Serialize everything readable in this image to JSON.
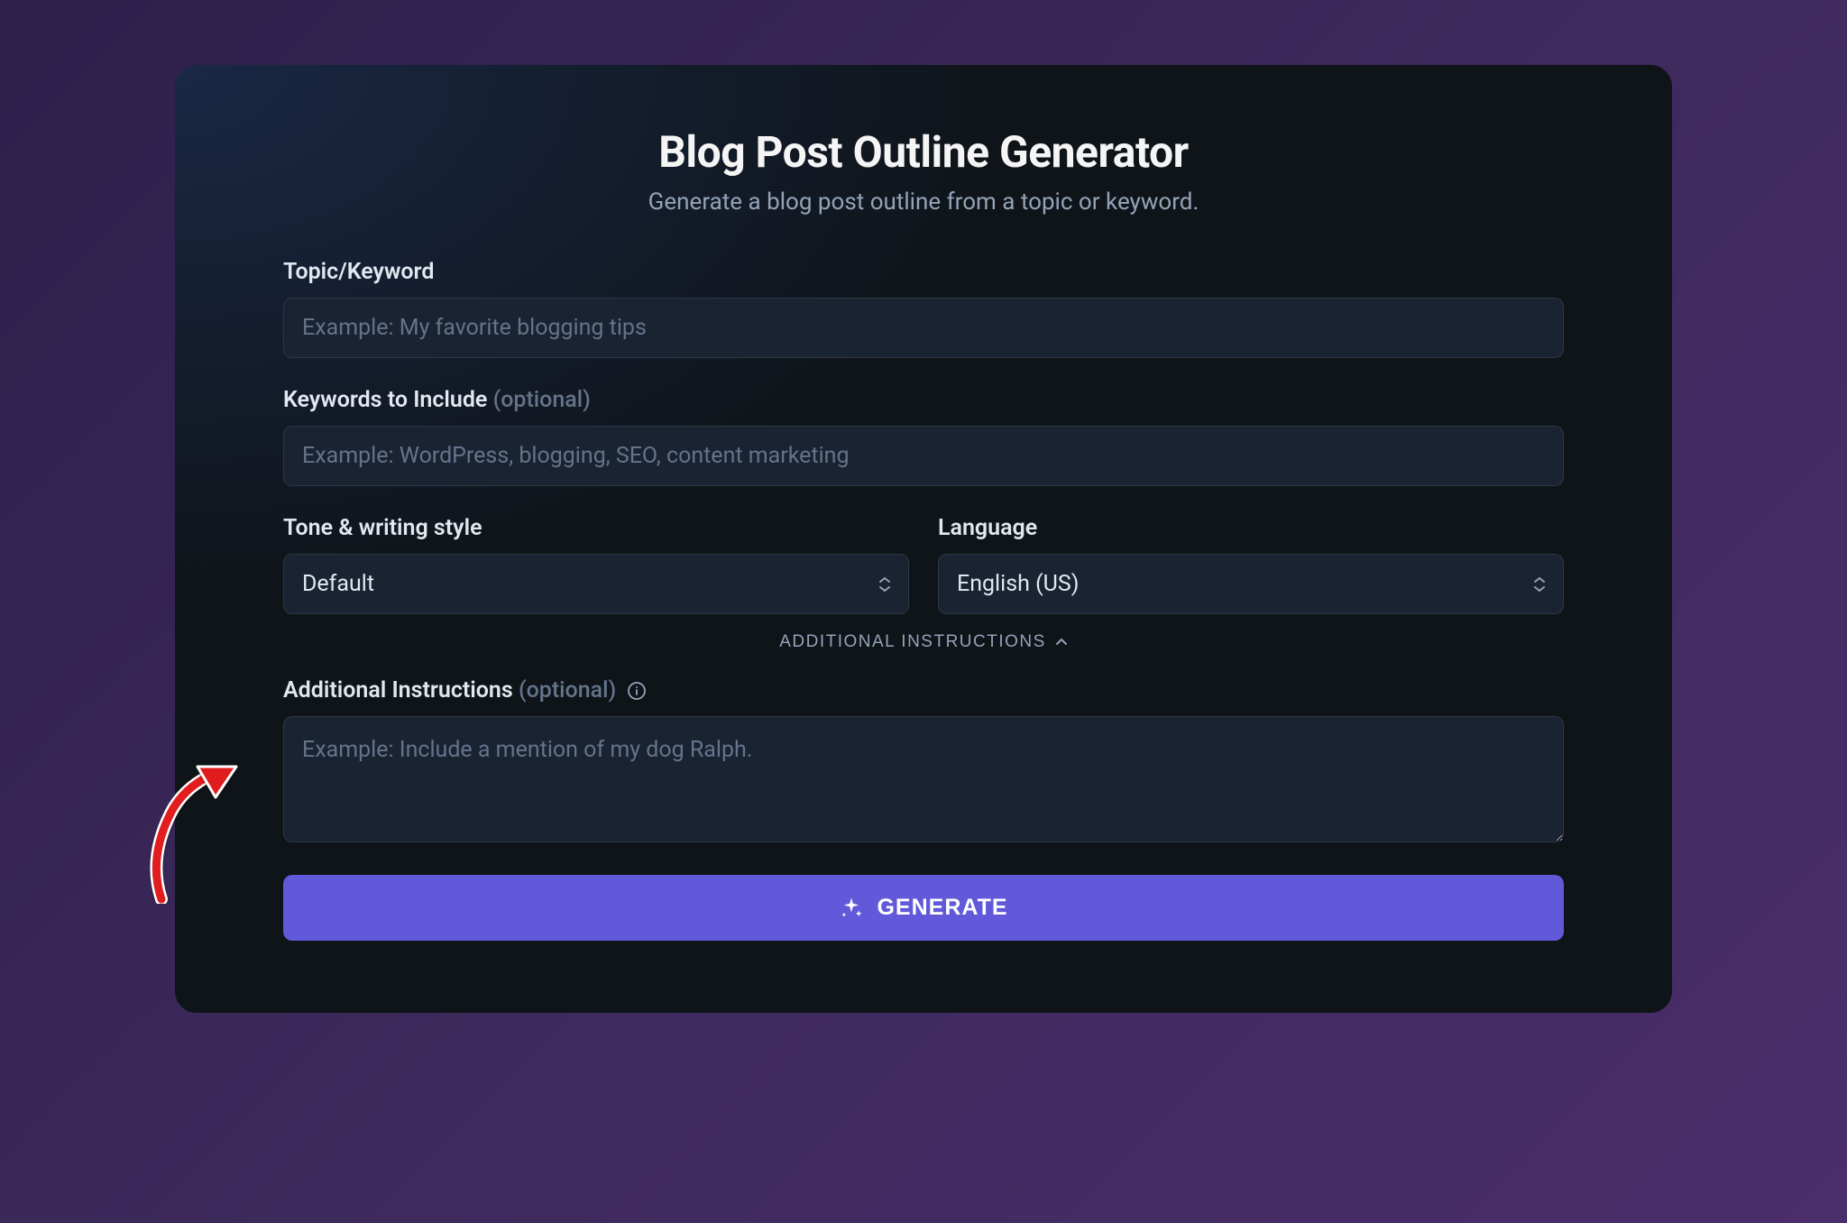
{
  "header": {
    "title": "Blog Post Outline Generator",
    "subtitle": "Generate a blog post outline from a topic or keyword."
  },
  "fields": {
    "topic": {
      "label": "Topic/Keyword",
      "placeholder": "Example: My favorite blogging tips",
      "value": ""
    },
    "keywords": {
      "label": "Keywords to Include",
      "optional_text": "(optional)",
      "placeholder": "Example: WordPress, blogging, SEO, content marketing",
      "value": ""
    },
    "tone": {
      "label": "Tone & writing style",
      "value": "Default"
    },
    "language": {
      "label": "Language",
      "value": "English (US)"
    },
    "additional": {
      "label": "Additional Instructions",
      "optional_text": "(optional)",
      "placeholder": "Example: Include a mention of my dog Ralph.",
      "value": ""
    }
  },
  "toggle": {
    "label": "ADDITIONAL INSTRUCTIONS"
  },
  "actions": {
    "generate": "GENERATE"
  }
}
